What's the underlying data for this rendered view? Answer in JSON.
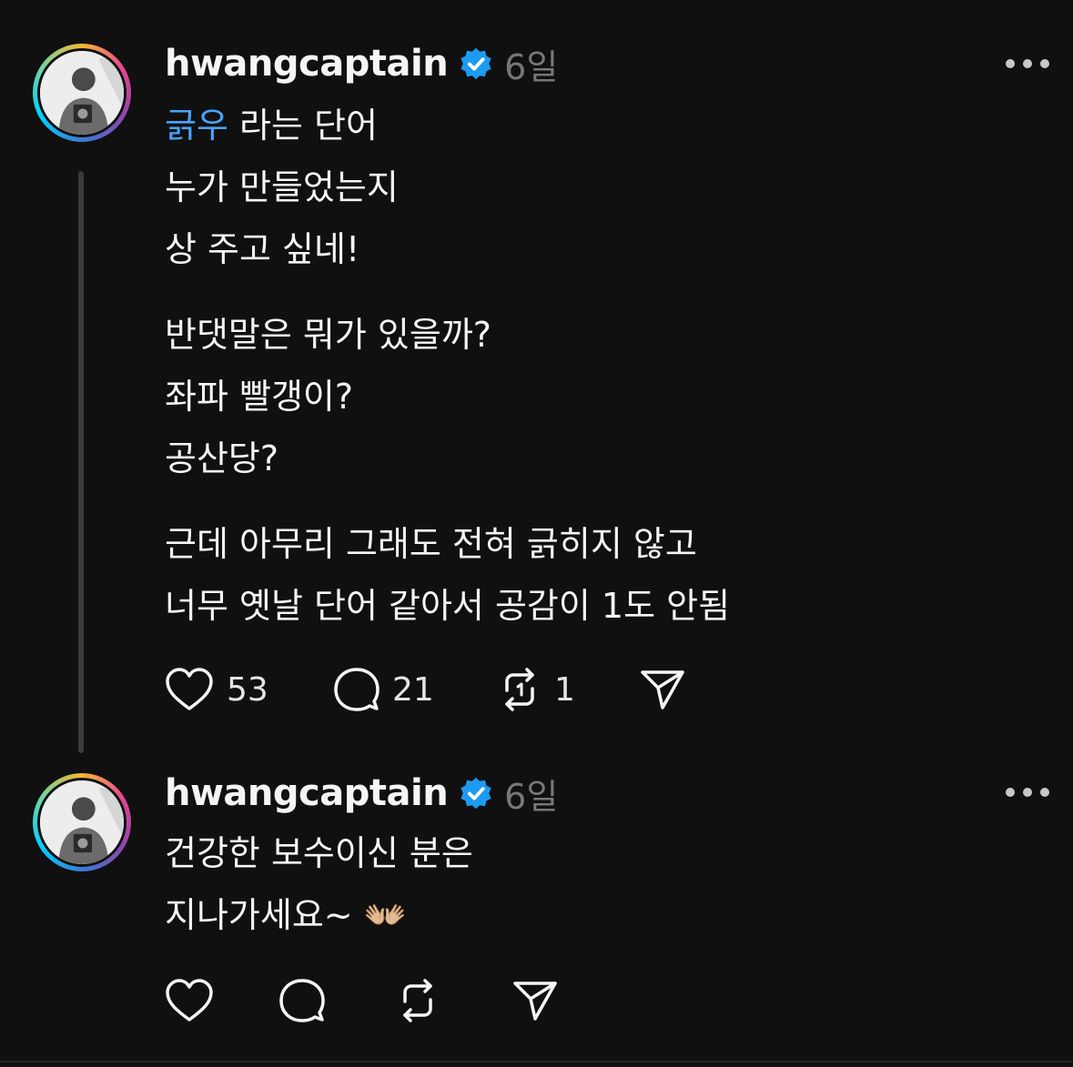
{
  "posts": [
    {
      "username": "hwangcaptain",
      "time": "6일",
      "lines_p1": [
        {
          "tag": "긁우",
          "rest": " 라는 단어"
        },
        "누가 만들었는지",
        "상 주고 싶네!"
      ],
      "lines_p2": [
        "반댓말은 뭐가 있을까?",
        "좌파 빨갱이?",
        "공산당?"
      ],
      "lines_p3": [
        "근데 아무리 그래도 전혀 긁히지 않고",
        "너무 옛날 단어 같아서 공감이 1도 안됨"
      ],
      "likes": "53",
      "replies": "21",
      "reposts": "1"
    },
    {
      "username": "hwangcaptain",
      "time": "6일",
      "lines": [
        "건강한 보수이신 분은",
        "지나가세요~ 👐🏼"
      ],
      "emoji_icon": "open-hands-emoji-icon"
    }
  ],
  "icons": {
    "verified": "verified-badge-icon",
    "like": "heart-icon",
    "reply": "comment-bubble-icon",
    "repost": "repost-icon",
    "share": "send-icon",
    "more": "more-dots-icon"
  },
  "colors": {
    "background": "#101010",
    "text": "#f3f5f7",
    "muted": "#777777",
    "tag": "#4aa3ff",
    "verified": "#1d9bf0"
  }
}
